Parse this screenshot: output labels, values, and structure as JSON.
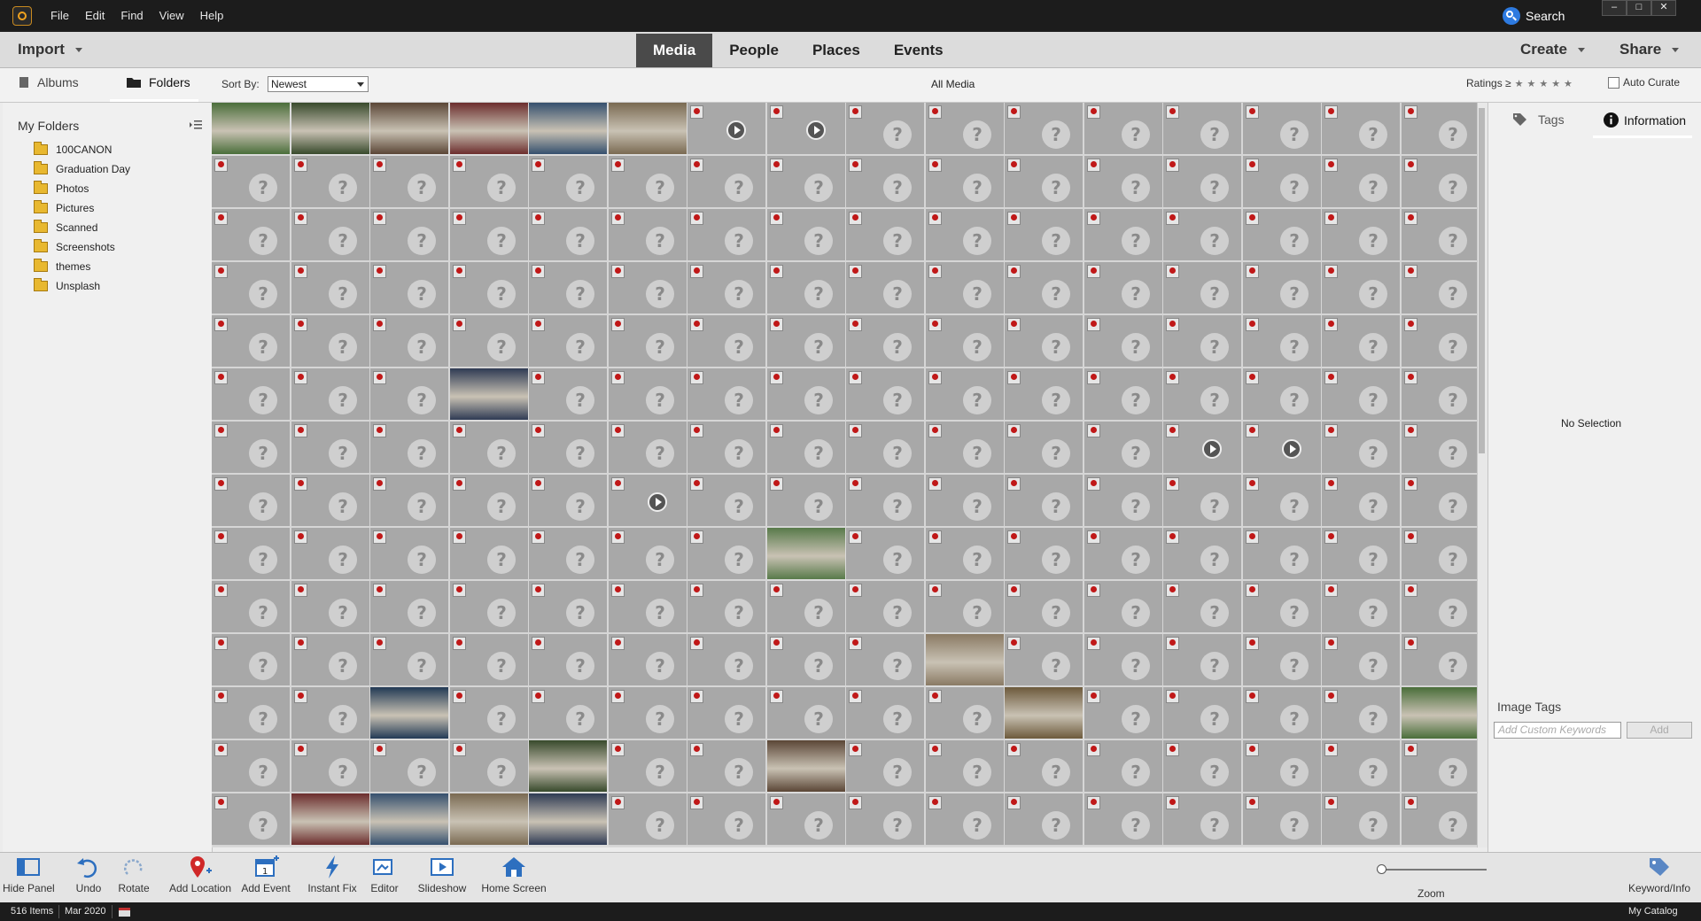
{
  "window": {
    "menu": [
      "File",
      "Edit",
      "Find",
      "View",
      "Help"
    ],
    "search_label": "Search",
    "controls": [
      "–",
      "□",
      "✕"
    ]
  },
  "toolbar": {
    "import_label": "Import",
    "tabs": [
      "Media",
      "People",
      "Places",
      "Events"
    ],
    "active_tab": "Media",
    "create_label": "Create",
    "share_label": "Share"
  },
  "subbar": {
    "albums_label": "Albums",
    "folders_label": "Folders",
    "sort_label": "Sort By:",
    "sort_value": "Newest",
    "view_title": "All Media",
    "ratings_label": "Ratings ≥",
    "ratings_stars": "★★★★★",
    "autocurate_label": "Auto Curate"
  },
  "left_panel": {
    "title": "My Folders",
    "folders": [
      "100CANON",
      "Graduation Day",
      "Photos",
      "Pictures",
      "Scanned",
      "Screenshots",
      "themes",
      "Unsplash"
    ]
  },
  "grid": {
    "placeholder_glyph": "?"
  },
  "right_panel": {
    "tags_tab": "Tags",
    "info_tab": "Information",
    "no_selection": "No Selection",
    "image_tags_label": "Image Tags",
    "keyword_placeholder": "Add Custom Keywords",
    "add_label": "Add"
  },
  "bottom_bar": {
    "hide_panel": "Hide Panel",
    "undo": "Undo",
    "rotate": "Rotate",
    "add_location": "Add Location",
    "add_event": "Add Event",
    "instant_fix": "Instant Fix",
    "editor": "Editor",
    "slideshow": "Slideshow",
    "home_screen": "Home Screen",
    "zoom": "Zoom",
    "keyword_info": "Keyword/Info",
    "zoom_level": 0
  },
  "status_bar": {
    "items_count": "516 Items",
    "date": "Mar 2020",
    "catalog": "My Catalog"
  },
  "colors": {
    "title_bg": "#1c1c1c",
    "active_tab_bg": "#4a4a4a",
    "grid_cell_bg": "#a8a8a8",
    "badge_red": "#c01818",
    "search_blue": "#2d7ae0"
  }
}
